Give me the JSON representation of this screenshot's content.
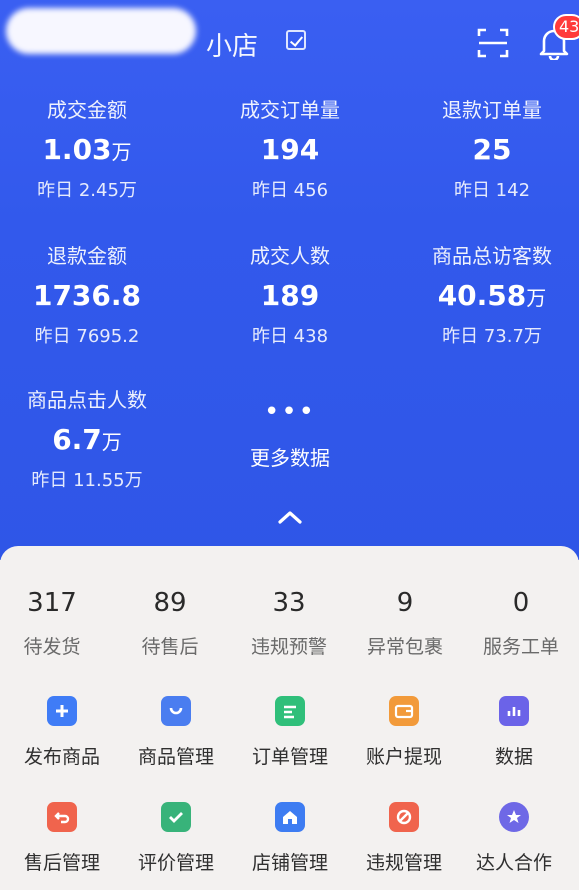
{
  "header": {
    "store_name_suffix": "小店",
    "notification_count": "43"
  },
  "metrics": [
    {
      "label": "成交金额",
      "value": "1.03",
      "unit": "万",
      "yesterday": "昨日 2.45万"
    },
    {
      "label": "成交订单量",
      "value": "194",
      "unit": "",
      "yesterday": "昨日 456"
    },
    {
      "label": "退款订单量",
      "value": "25",
      "unit": "",
      "yesterday": "昨日 142"
    },
    {
      "label": "退款金额",
      "value": "1736.8",
      "unit": "",
      "yesterday": "昨日 7695.2"
    },
    {
      "label": "成交人数",
      "value": "189",
      "unit": "",
      "yesterday": "昨日 438"
    },
    {
      "label": "商品总访客数",
      "value": "40.58",
      "unit": "万",
      "yesterday": "昨日 73.7万"
    },
    {
      "label": "商品点击人数",
      "value": "6.7",
      "unit": "万",
      "yesterday": "昨日 11.55万"
    }
  ],
  "more": {
    "dots": "•••",
    "label": "更多数据"
  },
  "counts": [
    {
      "num": "317",
      "label": "待发货"
    },
    {
      "num": "89",
      "label": "待售后"
    },
    {
      "num": "33",
      "label": "违规预警"
    },
    {
      "num": "9",
      "label": "异常包裹"
    },
    {
      "num": "0",
      "label": "服务工单"
    }
  ],
  "tools": [
    {
      "label": "发布商品",
      "icon": "publish-product-icon",
      "color": "#3f7cf6"
    },
    {
      "label": "商品管理",
      "icon": "product-bag-icon",
      "color": "#4a7df0"
    },
    {
      "label": "订单管理",
      "icon": "order-list-icon",
      "color": "#2fbf7a"
    },
    {
      "label": "账户提现",
      "icon": "wallet-icon",
      "color": "#f29a3a"
    },
    {
      "label": "数据",
      "icon": "chart-icon",
      "color": "#6b63e8"
    },
    {
      "label": "售后管理",
      "icon": "after-sales-icon",
      "color": "#f0644d"
    },
    {
      "label": "评价管理",
      "icon": "review-check-icon",
      "color": "#38b37a"
    },
    {
      "label": "店铺管理",
      "icon": "shop-house-icon",
      "color": "#3d7cf2"
    },
    {
      "label": "违规管理",
      "icon": "violation-icon",
      "color": "#f0644d"
    },
    {
      "label": "达人合作",
      "icon": "star-badge-icon",
      "color": "#6e68e6"
    }
  ]
}
